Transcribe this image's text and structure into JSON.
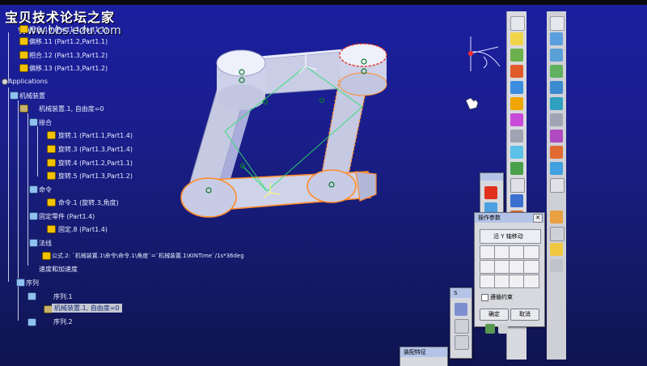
{
  "watermark": {
    "title": "宝贝技术论坛之家",
    "url": "www.bbs.edu.com"
  },
  "tree": {
    "items": [
      {
        "label": "相合.10 (Part1.1,Part1.1)"
      },
      {
        "label": "偏移.11 (Part1.2,Part1.1)"
      },
      {
        "label": "相合.12 (Part1.3,Part1.2)"
      },
      {
        "label": "偏移.13 (Part1.3,Part1.2)"
      },
      {
        "label": "Applications"
      },
      {
        "label": "机械装置"
      },
      {
        "label": "机械装置.1, 自由度=0"
      },
      {
        "label": "接合"
      },
      {
        "label": "旋转.1 (Part1.1,Part1.4)"
      },
      {
        "label": "旋转.3 (Part1.3,Part1.4)"
      },
      {
        "label": "旋转.4 (Part1.2,Part1.1)"
      },
      {
        "label": "旋转.5 (Part1.3,Part1.2)"
      },
      {
        "label": "命令"
      },
      {
        "label": "命令.1 (旋转.3,角度)"
      },
      {
        "label": "固定零件 (Part1.4)"
      },
      {
        "label": "固定.8 (Part1.4)"
      },
      {
        "label": "法线"
      },
      {
        "label": "公式.2: `机械装置.1\\命令\\命令.1\\角度`=`机械装置.1\\KINTime`/1s*36deg"
      },
      {
        "label": "速度和加速度"
      },
      {
        "label": "序列"
      },
      {
        "label": "序列.1"
      },
      {
        "label": "机械装置.1, 自由度=0"
      },
      {
        "label": "序列.2"
      }
    ]
  },
  "dialog_ops": {
    "title": "操作参数",
    "direction_label": "沿 Y 轴移动",
    "option_label": "遵循约束",
    "apply_label": "确定",
    "cancel_label": "取消"
  },
  "dialog_assembly": {
    "title": "装配特征"
  },
  "dialog_small": {
    "title": "S"
  },
  "colors": {
    "background": "#1b1fa0",
    "tree_text": "#e8ecff",
    "part_fill": "#c9cde6",
    "highlight": "#ff8c2a",
    "constraint_line": "#30e070"
  }
}
